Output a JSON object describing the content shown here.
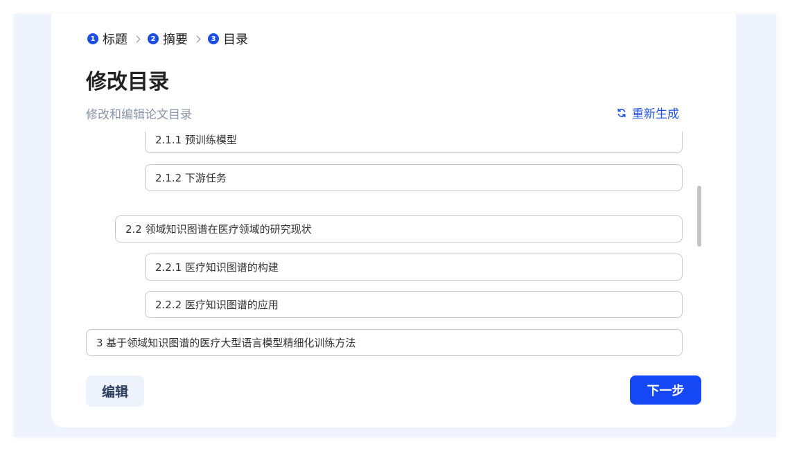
{
  "steps": [
    {
      "num": "1",
      "label": "标题"
    },
    {
      "num": "2",
      "label": "摘要"
    },
    {
      "num": "3",
      "label": "目录"
    }
  ],
  "header": {
    "title": "修改目录",
    "subtitle": "修改和编辑论文目录",
    "regenerate_label": "重新生成"
  },
  "toc": [
    {
      "level": 3,
      "text": "2.1.1 预训练模型"
    },
    {
      "level": 3,
      "text": "2.1.2 下游任务"
    },
    {
      "level": 2,
      "text": "2.2 领域知识图谱在医疗领域的研究现状"
    },
    {
      "level": 3,
      "text": "2.2.1 医疗知识图谱的构建"
    },
    {
      "level": 3,
      "text": "2.2.2 医疗知识图谱的应用"
    },
    {
      "level": 1,
      "text": "3 基于领域知识图谱的医疗大型语言模型精细化训练方法"
    },
    {
      "level": 2,
      "text": ""
    }
  ],
  "footer": {
    "edit_label": "编辑",
    "next_label": "下一步"
  },
  "icons": {
    "regenerate": "refresh-icon",
    "separator": "chevron-right-icon"
  },
  "colors": {
    "accent": "#1f4fe0",
    "primary_button": "#1648f5",
    "backdrop": "#eef3fd"
  }
}
